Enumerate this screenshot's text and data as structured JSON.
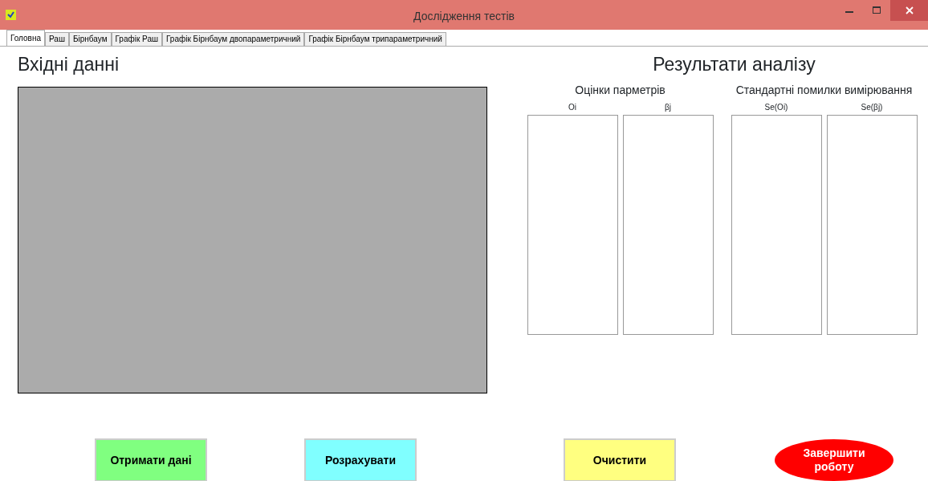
{
  "window": {
    "title": "Дослідження тестів"
  },
  "tabs": [
    {
      "label": "Головна",
      "selected": true
    },
    {
      "label": "Раш",
      "selected": false
    },
    {
      "label": "Бірнбаум",
      "selected": false
    },
    {
      "label": "Графік Раш",
      "selected": false
    },
    {
      "label": "Графік Бірнбаум двопараметричний",
      "selected": false
    },
    {
      "label": "Графік Бірнбаум трипараметричний",
      "selected": false
    }
  ],
  "input": {
    "heading": "Вхідні данні"
  },
  "results": {
    "heading": "Результати аналізу",
    "groups": [
      {
        "title": "Оцінки парметрів",
        "columns": [
          "Oi",
          "βj"
        ]
      },
      {
        "title": "Стандартні помилки вимірювання",
        "columns": [
          "Se(Oi)",
          "Se(βj)"
        ]
      }
    ]
  },
  "buttons": [
    {
      "label": "Отримати дані",
      "kind": "rect",
      "color": "#80ff80"
    },
    {
      "label": "Розрахувати",
      "kind": "rect",
      "color": "#80ffff"
    },
    {
      "label": "Очистити",
      "kind": "rect",
      "color": "#ffff80"
    },
    {
      "label": "Завершити роботу",
      "kind": "ellipse",
      "color": "#ff0000"
    }
  ]
}
